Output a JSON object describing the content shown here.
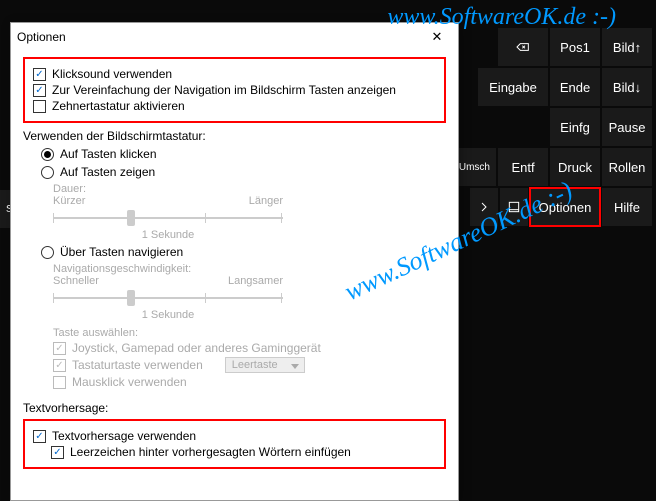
{
  "watermark": "www.SoftwareOK.de :-)",
  "dialog": {
    "title": "Optionen",
    "opt_clicksound": "Klicksound verwenden",
    "opt_navkeys": "Zur Vereinfachung der Navigation im Bildschirm Tasten anzeigen",
    "opt_numpad": "Zehnertastatur aktivieren",
    "use_osk_label": "Verwenden der Bildschirmtastatur:",
    "radio_click": "Auf Tasten klicken",
    "radio_hover": "Auf Tasten zeigen",
    "hover_duration_label": "Dauer:",
    "hover_shorter": "Kürzer",
    "hover_longer": "Länger",
    "hover_value": "1 Sekunde",
    "radio_scan": "Über Tasten navigieren",
    "scan_speed_label": "Navigationsgeschwindigkeit:",
    "scan_faster": "Schneller",
    "scan_slower": "Langsamer",
    "scan_value": "1 Sekunde",
    "select_key_label": "Taste auswählen:",
    "opt_joystick": "Joystick, Gamepad oder anderes Gaminggerät",
    "opt_kbkey": "Tastaturtaste verwenden",
    "combo_key": "Leertaste",
    "opt_mouseclick": "Mausklick verwenden",
    "textpred_label": "Textvorhersage:",
    "opt_textpred": "Textvorhersage verwenden",
    "opt_spaceafter": "Leerzeichen hinter vorhergesagten Wörtern einfügen"
  },
  "osk": {
    "pos1": "Pos1",
    "bildup": "Bild↑",
    "eingabe": "Eingabe",
    "ende": "Ende",
    "bilddown": "Bild↓",
    "einfg": "Einfg",
    "pause": "Pause",
    "entf": "Entf",
    "druck": "Druck",
    "rollen": "Rollen",
    "optionen": "Optionen",
    "hilfe": "Hilfe",
    "strg": "Strg",
    "umsch": "Umsch"
  }
}
